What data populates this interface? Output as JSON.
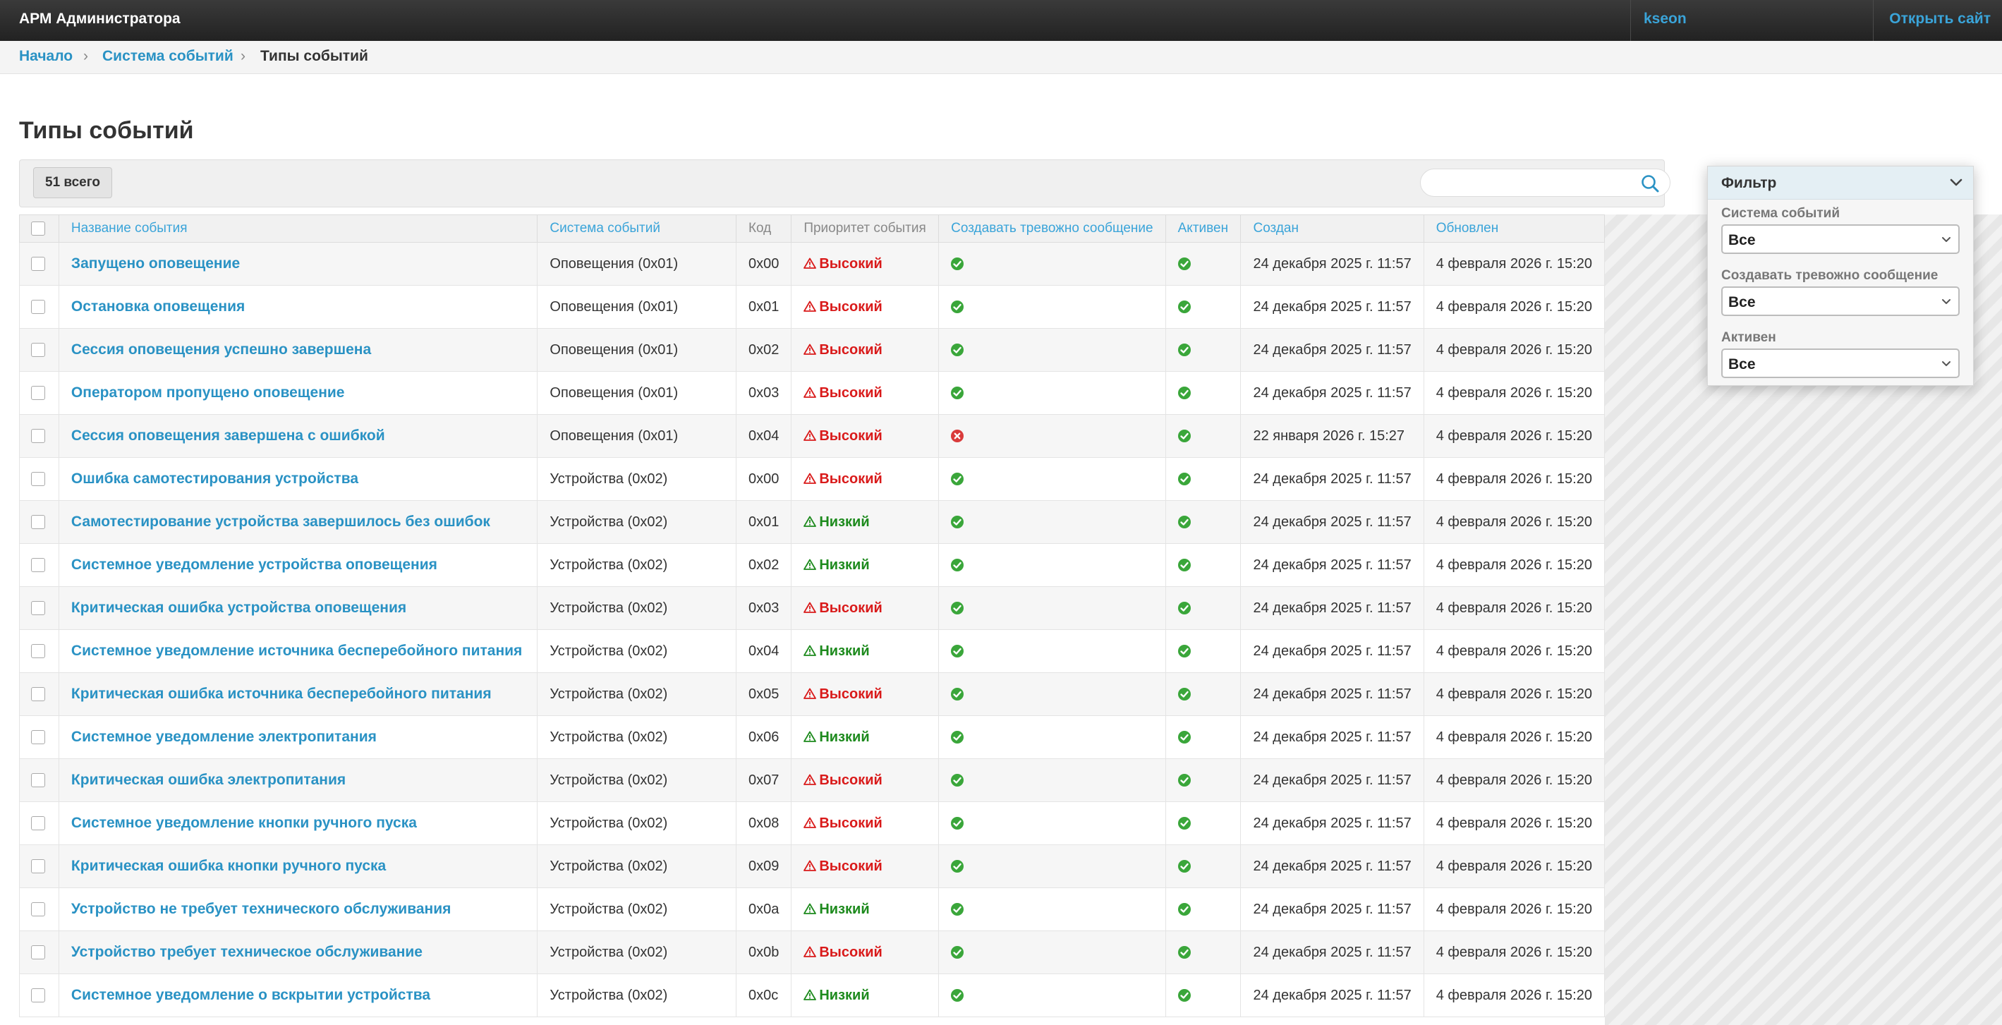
{
  "header": {
    "brand": "АРМ Администратора",
    "user": "kseon",
    "open_site": "Открыть сайт"
  },
  "breadcrumb": {
    "home": "Начало",
    "section": "Система событий",
    "current": "Типы событий"
  },
  "page_title": "Типы событий",
  "toolbar": {
    "count": "51 всего",
    "search_placeholder": ""
  },
  "table": {
    "columns": {
      "name": "Название события",
      "system": "Система событий",
      "code": "Код",
      "priority": "Приоритет события",
      "alarm": "Создавать тревожно сообщение",
      "active": "Активен",
      "created": "Создан",
      "updated": "Обновлен"
    },
    "rows": [
      {
        "name": "Запущено оповещение",
        "system": "Оповещения (0x01)",
        "code": "0x00",
        "priority": "Высокий",
        "level": "high",
        "alarm": true,
        "active": true,
        "created": "24 декабря 2025 г. 11:57",
        "updated": "4 февраля 2026 г. 15:20"
      },
      {
        "name": "Остановка оповещения",
        "system": "Оповещения (0x01)",
        "code": "0x01",
        "priority": "Высокий",
        "level": "high",
        "alarm": true,
        "active": true,
        "created": "24 декабря 2025 г. 11:57",
        "updated": "4 февраля 2026 г. 15:20"
      },
      {
        "name": "Сессия оповещения успешно завершена",
        "system": "Оповещения (0x01)",
        "code": "0x02",
        "priority": "Высокий",
        "level": "high",
        "alarm": true,
        "active": true,
        "created": "24 декабря 2025 г. 11:57",
        "updated": "4 февраля 2026 г. 15:20"
      },
      {
        "name": "Оператором пропущено оповещение",
        "system": "Оповещения (0x01)",
        "code": "0x03",
        "priority": "Высокий",
        "level": "high",
        "alarm": true,
        "active": true,
        "created": "24 декабря 2025 г. 11:57",
        "updated": "4 февраля 2026 г. 15:20"
      },
      {
        "name": "Сессия оповещения завершена с ошибкой",
        "system": "Оповещения (0x01)",
        "code": "0x04",
        "priority": "Высокий",
        "level": "high",
        "alarm": false,
        "active": true,
        "created": "22 января 2026 г. 15:27",
        "updated": "4 февраля 2026 г. 15:20"
      },
      {
        "name": "Ошибка самотестирования устройства",
        "system": "Устройства (0x02)",
        "code": "0x00",
        "priority": "Высокий",
        "level": "high",
        "alarm": true,
        "active": true,
        "created": "24 декабря 2025 г. 11:57",
        "updated": "4 февраля 2026 г. 15:20"
      },
      {
        "name": "Самотестирование устройства завершилось без ошибок",
        "system": "Устройства (0x02)",
        "code": "0x01",
        "priority": "Низкий",
        "level": "low",
        "alarm": true,
        "active": true,
        "created": "24 декабря 2025 г. 11:57",
        "updated": "4 февраля 2026 г. 15:20"
      },
      {
        "name": "Системное уведомление устройства оповещения",
        "system": "Устройства (0x02)",
        "code": "0x02",
        "priority": "Низкий",
        "level": "low",
        "alarm": true,
        "active": true,
        "created": "24 декабря 2025 г. 11:57",
        "updated": "4 февраля 2026 г. 15:20"
      },
      {
        "name": "Критическая ошибка устройства оповещения",
        "system": "Устройства (0x02)",
        "code": "0x03",
        "priority": "Высокий",
        "level": "high",
        "alarm": true,
        "active": true,
        "created": "24 декабря 2025 г. 11:57",
        "updated": "4 февраля 2026 г. 15:20"
      },
      {
        "name": "Системное уведомление источника бесперебойного питания",
        "system": "Устройства (0x02)",
        "code": "0x04",
        "priority": "Низкий",
        "level": "low",
        "alarm": true,
        "active": true,
        "created": "24 декабря 2025 г. 11:57",
        "updated": "4 февраля 2026 г. 15:20"
      },
      {
        "name": "Критическая ошибка источника бесперебойного питания",
        "system": "Устройства (0x02)",
        "code": "0x05",
        "priority": "Высокий",
        "level": "high",
        "alarm": true,
        "active": true,
        "created": "24 декабря 2025 г. 11:57",
        "updated": "4 февраля 2026 г. 15:20"
      },
      {
        "name": "Системное уведомление электропитания",
        "system": "Устройства (0x02)",
        "code": "0x06",
        "priority": "Низкий",
        "level": "low",
        "alarm": true,
        "active": true,
        "created": "24 декабря 2025 г. 11:57",
        "updated": "4 февраля 2026 г. 15:20"
      },
      {
        "name": "Критическая ошибка электропитания",
        "system": "Устройства (0x02)",
        "code": "0x07",
        "priority": "Высокий",
        "level": "high",
        "alarm": true,
        "active": true,
        "created": "24 декабря 2025 г. 11:57",
        "updated": "4 февраля 2026 г. 15:20"
      },
      {
        "name": "Системное уведомление кнопки ручного пуска",
        "system": "Устройства (0x02)",
        "code": "0x08",
        "priority": "Высокий",
        "level": "high",
        "alarm": true,
        "active": true,
        "created": "24 декабря 2025 г. 11:57",
        "updated": "4 февраля 2026 г. 15:20"
      },
      {
        "name": "Критическая ошибка кнопки ручного пуска",
        "system": "Устройства (0x02)",
        "code": "0x09",
        "priority": "Высокий",
        "level": "high",
        "alarm": true,
        "active": true,
        "created": "24 декабря 2025 г. 11:57",
        "updated": "4 февраля 2026 г. 15:20"
      },
      {
        "name": "Устройство не требует технического обслуживания",
        "system": "Устройства (0x02)",
        "code": "0x0a",
        "priority": "Низкий",
        "level": "low",
        "alarm": true,
        "active": true,
        "created": "24 декабря 2025 г. 11:57",
        "updated": "4 февраля 2026 г. 15:20"
      },
      {
        "name": "Устройство требует техническое обслуживание",
        "system": "Устройства (0x02)",
        "code": "0x0b",
        "priority": "Высокий",
        "level": "high",
        "alarm": true,
        "active": true,
        "created": "24 декабря 2025 г. 11:57",
        "updated": "4 февраля 2026 г. 15:20"
      },
      {
        "name": "Системное уведомление о вскрытии устройства",
        "system": "Устройства (0x02)",
        "code": "0x0c",
        "priority": "Низкий",
        "level": "low",
        "alarm": true,
        "active": true,
        "created": "24 декабря 2025 г. 11:57",
        "updated": "4 февраля 2026 г. 15:20"
      }
    ]
  },
  "filter": {
    "title": "Фильтр",
    "groups": [
      {
        "label": "Система событий",
        "value": "Все"
      },
      {
        "label": "Создавать тревожно сообщение",
        "value": "Все"
      },
      {
        "label": "Активен",
        "value": "Все"
      }
    ]
  },
  "colors": {
    "link": "#2a92c4",
    "high": "#d91a1a",
    "low": "#1d8a1d",
    "ok": "#3aa63a",
    "no": "#d93b3b"
  }
}
